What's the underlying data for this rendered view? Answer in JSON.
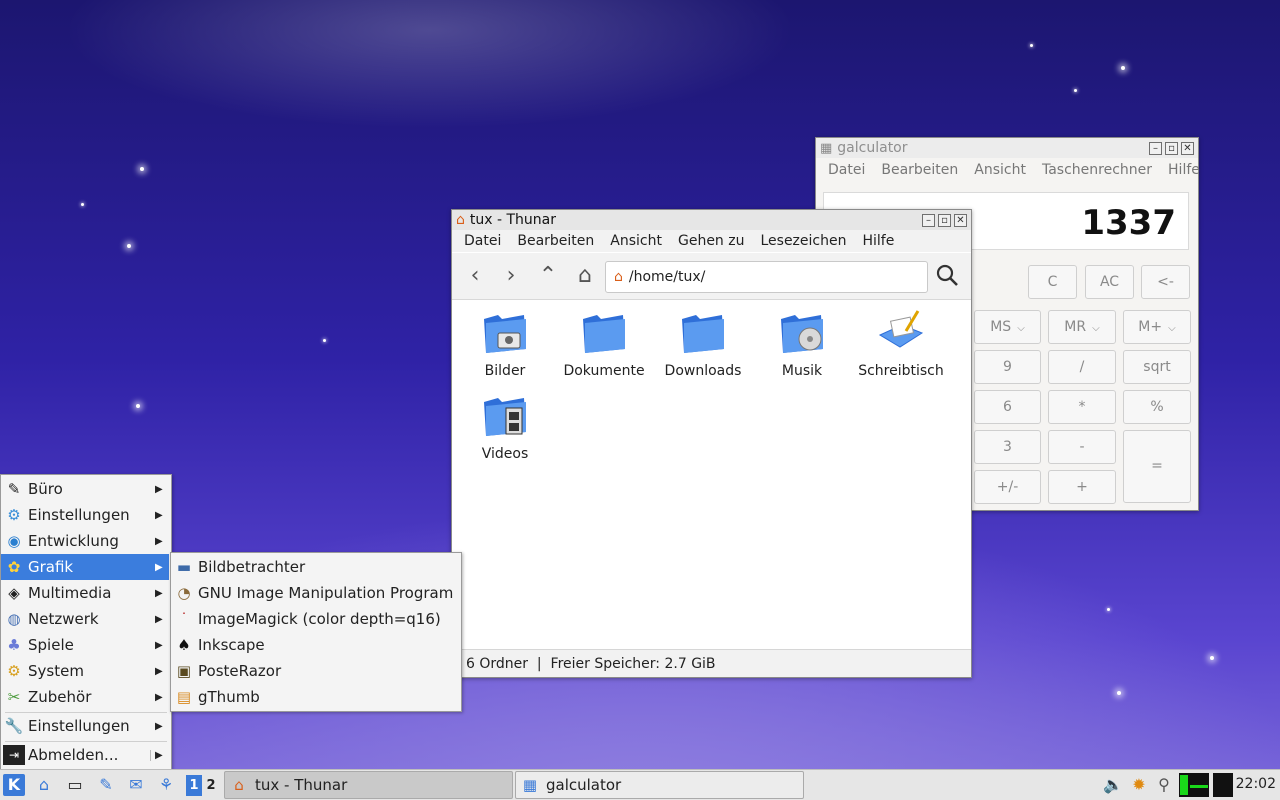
{
  "calculator": {
    "title": "galculator",
    "menu": [
      "Datei",
      "Bearbeiten",
      "Ansicht",
      "Taschenrechner",
      "Hilfe"
    ],
    "display_value": "1337",
    "buttons": {
      "c": "C",
      "ac": "AC",
      "backspace": "<-",
      "ms": "MS",
      "mr": "MR",
      "mplus": "M+",
      "nine": "9",
      "divide": "/",
      "sqrt": "sqrt",
      "six": "6",
      "multiply": "*",
      "percent": "%",
      "three": "3",
      "minus": "-",
      "equals": "=",
      "plusminus": "+/-",
      "plus": "+"
    }
  },
  "thunar": {
    "title": "tux - Thunar",
    "menu": [
      "Datei",
      "Bearbeiten",
      "Ansicht",
      "Gehen zu",
      "Lesezeichen",
      "Hilfe"
    ],
    "path": "/home/tux/",
    "folders": [
      "Bilder",
      "Dokumente",
      "Downloads",
      "Musik",
      "Schreibtisch",
      "Videos"
    ],
    "status": "6 Ordner  |  Freier Speicher: 2.7 GiB"
  },
  "start_menu": {
    "items": [
      "Büro",
      "Einstellungen",
      "Entwicklung",
      "Grafik",
      "Multimedia",
      "Netzwerk",
      "Spiele",
      "System",
      "Zubehör"
    ],
    "settings": "Einstellungen",
    "logout": "Abmelden...",
    "grafik_submenu": [
      "Bildbetrachter",
      "GNU Image Manipulation Program",
      "ImageMagick (color depth=q16)",
      "Inkscape",
      "PosteRazor",
      "gThumb"
    ]
  },
  "taskbar": {
    "desktops": [
      "1",
      "2"
    ],
    "tasks": [
      "tux - Thunar",
      "galculator"
    ],
    "clock": "22:02"
  },
  "colors": {
    "selection": "#3b7ddd",
    "folder_blue": "#2f6fd8"
  }
}
